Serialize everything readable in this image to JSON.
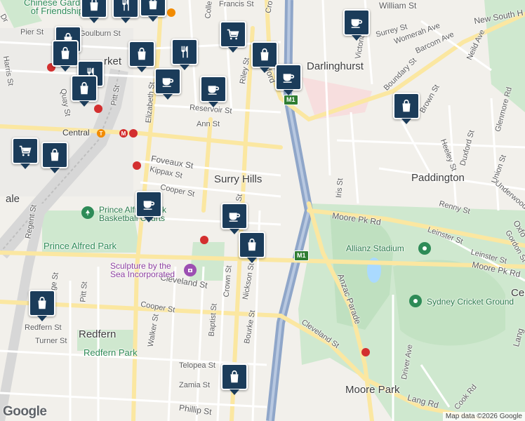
{
  "suburbs": {
    "surry_hills": "Surry Hills",
    "darlinghurst": "Darlinghurst",
    "paddington": "Paddington",
    "redfern": "Redfern",
    "moore_park": "Moore Park",
    "central": "Central",
    "haymarket": "rket",
    "ultimo": "ale",
    "centennial": "Cer"
  },
  "streets": {
    "goulburn": "Goulburn St",
    "pier": "Pier St",
    "harris": "Harris St",
    "quay": "Quay St",
    "pitt": "Pitt St",
    "elizabeth": "Elizabeth St",
    "reservoir": "Reservoir St",
    "ann": "Ann St",
    "foveaux": "Foveaux St",
    "kippax": "Kippax St",
    "cooper": "Cooper St",
    "riley": "Riley St",
    "crown": "Crown St",
    "nickson": "Nickson St",
    "cleveland": "Cleveland St",
    "cleveland2": "Cleveland St",
    "regent": "Regent St",
    "pitt2": "Pitt St",
    "cooper2": "Cooper St",
    "walker": "Walker St",
    "turner": "Turner St",
    "baptist": "Baptist St",
    "bourke": "Bourke St",
    "telopea": "Telopea St",
    "zamia": "Zamia St",
    "phillip": "Phillip St",
    "redfern_st": "Redfern St",
    "george": "ge St",
    "moore_pk": "Moore Pk Rd",
    "moore_pk2": "Moore Pk Rd",
    "anzac": "Anzac Parade",
    "iris": "Iris St",
    "renny": "Renny St",
    "leinster": "Leinster St",
    "leinster2": "Leinster St",
    "gordon": "Gordon St",
    "underwood": "Underwood",
    "union": "Union St",
    "glenmore": "Glenmore Rd",
    "duxford": "Duxford St",
    "heeley": "Heeley St",
    "brown": "Brown St",
    "boundary": "Boundary St",
    "barcom": "Barcom Ave",
    "womerah": "Womerah Ave",
    "surrey": "Surrey St",
    "victoria": "Victoria",
    "neild": "Neild Ave",
    "new_south": "New South H",
    "william": "William St",
    "francis": "Francis St",
    "college": "Colle",
    "oxford": "Oxford",
    "crown_top": "Cro",
    "driver": "Driver Ave",
    "lang": "Lang Rd",
    "cook": "Cook Rd",
    "lang_right": "Lang",
    "oxford_right": "Oxfo",
    "st_top": "St",
    "dr": "Dr"
  },
  "places": {
    "chinese_garden": "Chinese Garden\nof Friendship",
    "prince_alfred_basketball": "Prince Alfred Park\nBasketball Courts",
    "prince_alfred_park": "Prince Alfred Park",
    "sculpture": "Sculpture by the\nSea Incorporated",
    "redfern_park": "Redfern Park",
    "allianz": "Allianz Stadium",
    "scg": "Sydney Cricket Ground"
  },
  "road_badges": {
    "m1_top": "M1",
    "m1_mid": "M1"
  },
  "station_central": {
    "t": "T",
    "m": "M"
  },
  "markers": [
    {
      "type": "shopping",
      "name": "shopping-marker-1"
    },
    {
      "type": "restaurant"
    },
    {
      "type": "shopping"
    },
    {
      "type": "restaurant"
    },
    {
      "type": "shopping"
    },
    {
      "type": "shopping"
    },
    {
      "type": "restaurant"
    },
    {
      "type": "cafe"
    },
    {
      "type": "grocery"
    },
    {
      "type": "shopping"
    },
    {
      "type": "shopping"
    },
    {
      "type": "cafe"
    },
    {
      "type": "cafe"
    },
    {
      "type": "cafe"
    },
    {
      "type": "grocery"
    },
    {
      "type": "shopping"
    },
    {
      "type": "shopping"
    },
    {
      "type": "cafe"
    },
    {
      "type": "cafe"
    },
    {
      "type": "shopping"
    },
    {
      "type": "shopping"
    },
    {
      "type": "shopping"
    },
    {
      "type": "shopping"
    }
  ],
  "google_logo": "Google",
  "attribution": "Map data ©2026 Google",
  "colors": {
    "marker": "#1b3c5a",
    "park": "#c8e6c9",
    "motorway": "#8fa6c9",
    "road_major": "#fbe7a1",
    "water": "#aadaff"
  }
}
